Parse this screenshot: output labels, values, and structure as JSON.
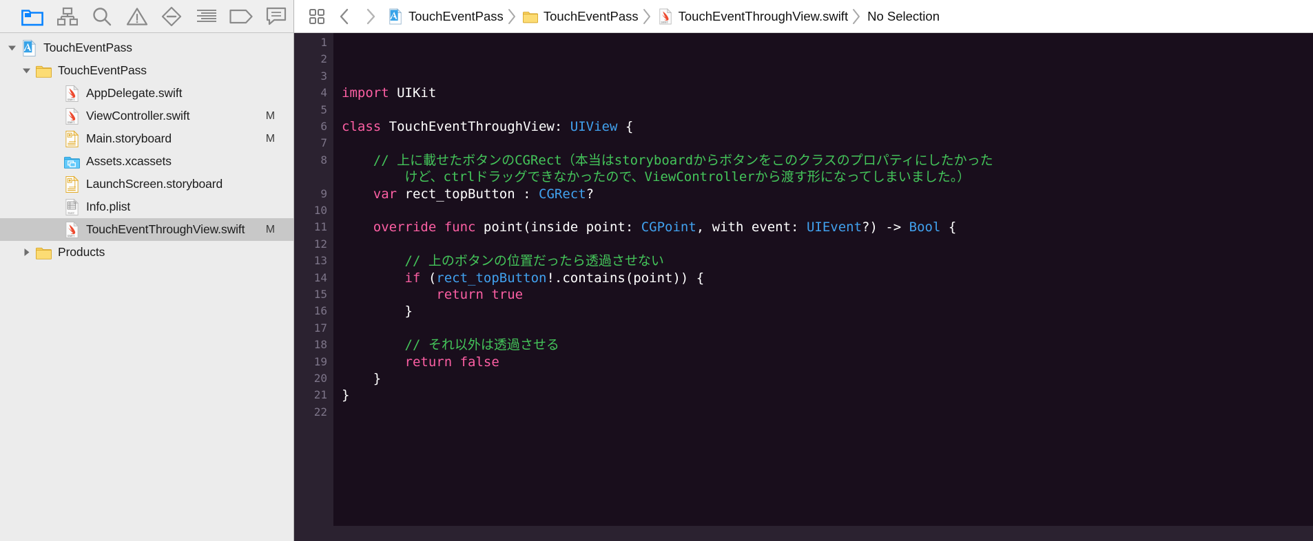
{
  "navigator": {
    "toolbar": [
      {
        "name": "folder-icon",
        "label": "Project navigator",
        "active": true
      },
      {
        "name": "source-control-icon",
        "label": "Source control navigator",
        "active": false
      },
      {
        "name": "search-icon",
        "label": "Find navigator",
        "active": false
      },
      {
        "name": "warning-icon",
        "label": "Issue navigator",
        "active": false
      },
      {
        "name": "test-diamond-icon",
        "label": "Test navigator",
        "active": false
      },
      {
        "name": "debug-list-icon",
        "label": "Debug navigator",
        "active": false
      },
      {
        "name": "breakpoint-tag-icon",
        "label": "Breakpoint navigator",
        "active": false
      },
      {
        "name": "report-comment-icon",
        "label": "Report navigator",
        "active": false
      }
    ],
    "tree": [
      {
        "label": "TouchEventPass",
        "icon": "xcode-project-icon",
        "indent": 0,
        "twisty": "open",
        "badge": "",
        "selected": false
      },
      {
        "label": "TouchEventPass",
        "icon": "folder-icon",
        "indent": 1,
        "twisty": "open",
        "badge": "",
        "selected": false
      },
      {
        "label": "AppDelegate.swift",
        "icon": "swift-file-icon",
        "indent": 2,
        "twisty": "none",
        "badge": "",
        "selected": false
      },
      {
        "label": "ViewController.swift",
        "icon": "swift-file-icon",
        "indent": 2,
        "twisty": "none",
        "badge": "M",
        "selected": false
      },
      {
        "label": "Main.storyboard",
        "icon": "storyboard-file-icon",
        "indent": 2,
        "twisty": "none",
        "badge": "M",
        "selected": false
      },
      {
        "label": "Assets.xcassets",
        "icon": "xcassets-icon",
        "indent": 2,
        "twisty": "none",
        "badge": "",
        "selected": false
      },
      {
        "label": "LaunchScreen.storyboard",
        "icon": "storyboard-file-icon",
        "indent": 2,
        "twisty": "none",
        "badge": "",
        "selected": false
      },
      {
        "label": "Info.plist",
        "icon": "plist-file-icon",
        "indent": 2,
        "twisty": "none",
        "badge": "",
        "selected": false
      },
      {
        "label": "TouchEventThroughView.swift",
        "icon": "swift-file-icon",
        "indent": 2,
        "twisty": "none",
        "badge": "M",
        "selected": true
      },
      {
        "label": "Products",
        "icon": "folder-icon",
        "indent": 1,
        "twisty": "closed",
        "badge": "",
        "selected": false
      }
    ]
  },
  "jump_bar": {
    "grid_icon": "related-items-icon",
    "back_arrow": "chevron-left-icon",
    "forward_arrow": "chevron-right-icon",
    "crumbs": [
      {
        "label": "TouchEventPass",
        "icon": "xcode-project-icon"
      },
      {
        "label": "TouchEventPass",
        "icon": "folder-icon"
      },
      {
        "label": "TouchEventThroughView.swift",
        "icon": "swift-file-icon"
      },
      {
        "label": "No Selection",
        "icon": "none"
      }
    ]
  },
  "editor": {
    "filename": "TouchEventThroughView.swift",
    "theme": {
      "background": "#190e1c",
      "gutter_background": "#2b2230",
      "gutter_text": "#7d7589",
      "keyword": "#fc5fa3",
      "type": "#41a1ee",
      "comment": "#44c55a",
      "plain": "#ffffff"
    },
    "line_numbers": [
      1,
      2,
      3,
      4,
      5,
      6,
      7,
      8,
      9,
      10,
      11,
      12,
      13,
      14,
      15,
      16,
      17,
      18,
      19,
      20,
      21,
      22
    ],
    "lines": [
      {
        "n": 1,
        "segs": []
      },
      {
        "n": 2,
        "segs": []
      },
      {
        "n": 3,
        "segs": []
      },
      {
        "n": 4,
        "segs": [
          {
            "t": "import",
            "c": "kw"
          },
          {
            "t": " UIKit",
            "c": "pl"
          }
        ]
      },
      {
        "n": 5,
        "segs": []
      },
      {
        "n": 6,
        "segs": [
          {
            "t": "class",
            "c": "kw"
          },
          {
            "t": " TouchEventThroughView: ",
            "c": "pl"
          },
          {
            "t": "UIView",
            "c": "ty"
          },
          {
            "t": " {",
            "c": "pl"
          }
        ]
      },
      {
        "n": 7,
        "segs": []
      },
      {
        "n": 8,
        "segs": [
          {
            "t": "    // 上に載せたボタンのCGRect（本当はstoryboardからボタンをこのクラスのプロパティにしたかった",
            "c": "cm"
          }
        ]
      },
      {
        "n": "8b",
        "segs": [
          {
            "t": "        けど、ctrlドラッグできなかったので、ViewControllerから渡す形になってしまいました。）",
            "c": "cm"
          }
        ]
      },
      {
        "n": 9,
        "segs": [
          {
            "t": "    ",
            "c": "pl"
          },
          {
            "t": "var",
            "c": "kw"
          },
          {
            "t": " rect_topButton : ",
            "c": "pl"
          },
          {
            "t": "CGRect",
            "c": "ty"
          },
          {
            "t": "?",
            "c": "pl"
          }
        ]
      },
      {
        "n": 10,
        "segs": []
      },
      {
        "n": 11,
        "segs": [
          {
            "t": "    ",
            "c": "pl"
          },
          {
            "t": "override func",
            "c": "kw"
          },
          {
            "t": " point(inside point: ",
            "c": "pl"
          },
          {
            "t": "CGPoint",
            "c": "ty"
          },
          {
            "t": ", with event: ",
            "c": "pl"
          },
          {
            "t": "UIEvent",
            "c": "ty"
          },
          {
            "t": "?) -> ",
            "c": "pl"
          },
          {
            "t": "Bool",
            "c": "ty"
          },
          {
            "t": " {",
            "c": "pl"
          }
        ]
      },
      {
        "n": 12,
        "segs": []
      },
      {
        "n": 13,
        "segs": [
          {
            "t": "        // 上のボタンの位置だったら透過させない",
            "c": "cm"
          }
        ]
      },
      {
        "n": 14,
        "segs": [
          {
            "t": "        ",
            "c": "pl"
          },
          {
            "t": "if",
            "c": "kw"
          },
          {
            "t": " (",
            "c": "pl"
          },
          {
            "t": "rect_topButton",
            "c": "ty"
          },
          {
            "t": "!.contains(point)) {",
            "c": "pl"
          }
        ]
      },
      {
        "n": 15,
        "segs": [
          {
            "t": "            ",
            "c": "pl"
          },
          {
            "t": "return true",
            "c": "kw"
          }
        ]
      },
      {
        "n": 16,
        "segs": [
          {
            "t": "        }",
            "c": "pl"
          }
        ]
      },
      {
        "n": 17,
        "segs": []
      },
      {
        "n": 18,
        "segs": [
          {
            "t": "        // それ以外は透過させる",
            "c": "cm"
          }
        ]
      },
      {
        "n": 19,
        "segs": [
          {
            "t": "        ",
            "c": "pl"
          },
          {
            "t": "return false",
            "c": "kw"
          }
        ]
      },
      {
        "n": 20,
        "segs": [
          {
            "t": "    }",
            "c": "pl"
          }
        ]
      },
      {
        "n": 21,
        "segs": [
          {
            "t": "}",
            "c": "pl"
          }
        ]
      },
      {
        "n": 22,
        "segs": []
      }
    ]
  }
}
